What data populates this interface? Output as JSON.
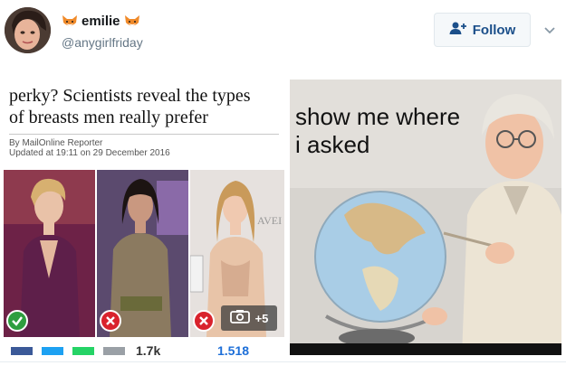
{
  "author": {
    "display_name": "emilie",
    "handle": "@anygirlfriday",
    "name_emoji_icon": "fox-face-icon"
  },
  "follow_button": {
    "label": "Follow",
    "icon": "add-user-icon"
  },
  "menu_icon": "chevron-down-icon",
  "media": {
    "article": {
      "headline_lines": [
        "perky? Scientists reveal the types",
        "of breasts men really prefer"
      ],
      "byline": "By MailOnline Reporter",
      "updated": "Updated at 19:11 on 29 December 2016",
      "photo_verdicts": [
        "check",
        "cross",
        "cross"
      ],
      "gallery_count": "+5",
      "share_counts": [
        "1.7k",
        "1,518"
      ]
    },
    "meme": {
      "caption_lines": [
        "show me where",
        "i asked"
      ]
    }
  },
  "colors": {
    "accent": "#1b4f8a",
    "check": "#2e9e3f",
    "cross": "#d9232d"
  }
}
